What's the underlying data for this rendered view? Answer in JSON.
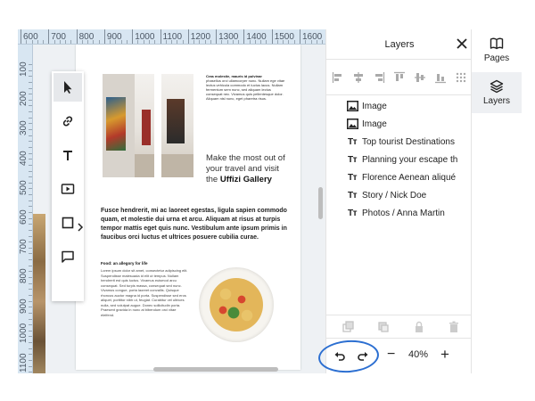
{
  "ruler": {
    "top_labels": [
      "600",
      "700",
      "800",
      "900",
      "1000",
      "1100",
      "1200",
      "1300",
      "1400",
      "1500",
      "1600"
    ],
    "left_labels": [
      "100",
      "200",
      "300",
      "400",
      "500",
      "600",
      "700",
      "800",
      "900",
      "1000",
      "1100"
    ]
  },
  "tools": [
    {
      "name": "select-tool",
      "icon": "cursor-icon"
    },
    {
      "name": "link-tool",
      "icon": "link-icon"
    },
    {
      "name": "text-tool",
      "icon": "text-icon"
    },
    {
      "name": "media-tool",
      "icon": "play-icon"
    },
    {
      "name": "shape-tool",
      "icon": "square-icon"
    },
    {
      "name": "comment-tool",
      "icon": "comment-icon"
    }
  ],
  "page": {
    "top_text_head": "Cras molestie, mauris id pulvinar",
    "top_text_body": "phasellus orci ullamcorper nunc. Nullam ege vitae lectus vehicula commodo et luctus lacus. Nullam fermentum sem nunc, sed aliquam lectus consequat nec. Vivamus quis pellentesque dolor. Aliquam nisl nunc, eget pharetra risus.",
    "tagline_prefix": "Make the most out of your travel and visit the",
    "tagline_bold": "Uffizi Gallery",
    "bold_paragraph": "Fusce hendrerit, mi ac laoreet egestas, ligula sapien commodo quam, et molestie dui urna et arcu. Aliquam at risus at turpis tempor mattis eget quis nunc. Vestibulum ante ipsum primis in faucibus orci luctus et ultrices posuere cubilia curae.",
    "food_heading": "Food: an allegory for life",
    "food_body": "Lorem ipsum dolor sit amet, consectetur adipiscing elit. Suspendisse malesuada id elit ut tempus. Nullam hendrerit est quis luctus. Vivamus euismod arcu consequat. Sed turpis massa, consequat sed nunc. Vivamus congue, porta laoreet convallis. Quisque rhoncus auctor magna id porta. Suspendisse sed eros aliquet, porttitor nibh ut, feugiat. Curabitur vel ultrices nulla, sed volutpat augue. Donec sollicitudin porta. Praesent gravida in nunc at bibendum orci vitae eleifend."
  },
  "layers_panel": {
    "title": "Layers",
    "items": [
      {
        "type": "image",
        "label": "Image"
      },
      {
        "type": "image",
        "label": "Image"
      },
      {
        "type": "text",
        "label": "Top tourist Destinations"
      },
      {
        "type": "text",
        "label": "Planning your escape th"
      },
      {
        "type": "text",
        "label": "Florence Aenean aliqué"
      },
      {
        "type": "text",
        "label": "Story / Nick Doe"
      },
      {
        "type": "text",
        "label": "Photos / Anna Martin"
      }
    ],
    "text_glyph": "Tт",
    "zoom": "40%",
    "zoom_minus": "−",
    "zoom_plus": "+"
  },
  "rail": [
    {
      "label": "Pages",
      "icon": "book-icon",
      "active": false
    },
    {
      "label": "Layers",
      "icon": "layers-icon",
      "active": true
    }
  ],
  "colors": {
    "accent_circle": "#2c6fd1",
    "ruler_bg": "#d8e6f2"
  }
}
